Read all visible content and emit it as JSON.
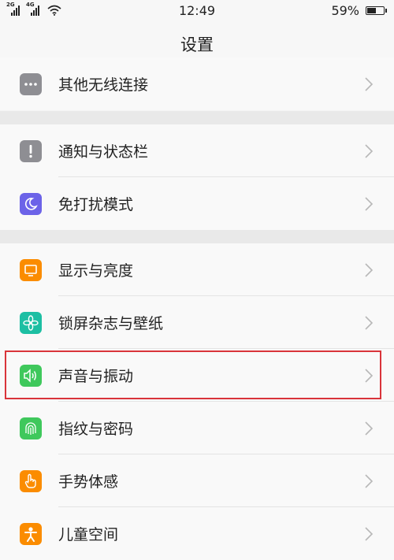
{
  "status_bar": {
    "network_1": "2G",
    "network_2": "4G",
    "time": "12:49",
    "battery": "59%",
    "battery_level": 0.59
  },
  "header": {
    "title": "设置"
  },
  "groups": [
    {
      "items": [
        {
          "label": "其他无线连接",
          "icon": "more-dots-icon",
          "color": "#8e8e93"
        }
      ]
    },
    {
      "items": [
        {
          "label": "通知与状态栏",
          "icon": "exclamation-icon",
          "color": "#8e8e93"
        },
        {
          "label": "免打扰模式",
          "icon": "moon-icon",
          "color": "#6c63e8"
        }
      ]
    },
    {
      "items": [
        {
          "label": "显示与亮度",
          "icon": "display-icon",
          "color": "#fb8c00"
        },
        {
          "label": "锁屏杂志与壁纸",
          "icon": "flower-icon",
          "color": "#1dbfa3"
        },
        {
          "label": "声音与振动",
          "icon": "speaker-icon",
          "color": "#3fc85c"
        },
        {
          "label": "指纹与密码",
          "icon": "fingerprint-icon",
          "color": "#3fc85c"
        },
        {
          "label": "手势体感",
          "icon": "gesture-hand-icon",
          "color": "#fb8c00"
        },
        {
          "label": "儿童空间",
          "icon": "child-icon",
          "color": "#fb8c00"
        }
      ]
    }
  ],
  "highlight_color": "#d9343a"
}
